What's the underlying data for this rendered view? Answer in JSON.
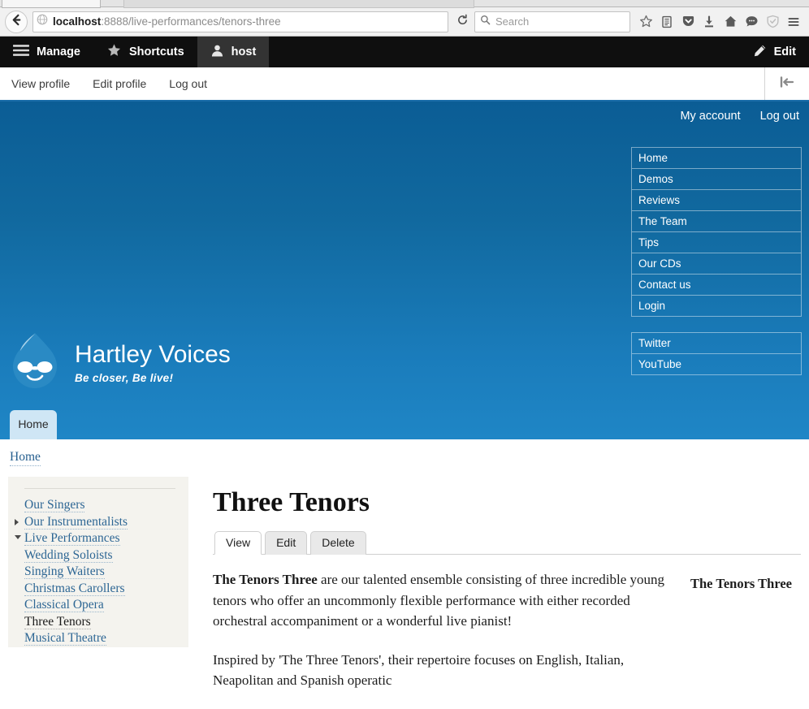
{
  "browser": {
    "url_host": "localhost",
    "url_rest": ":8888/live-performances/tenors-three",
    "search_placeholder": "Search"
  },
  "admin_toolbar": {
    "tabs": [
      {
        "label": "Manage",
        "icon": "hamburger-icon",
        "active": false
      },
      {
        "label": "Shortcuts",
        "icon": "star-icon",
        "active": false
      },
      {
        "label": "host",
        "icon": "user-icon",
        "active": true
      }
    ],
    "edit_label": "Edit",
    "submenu": [
      "View profile",
      "Edit profile",
      "Log out"
    ]
  },
  "hero": {
    "user_links": [
      "My account",
      "Log out"
    ],
    "primary_menu": [
      "Home",
      "Demos",
      "Reviews",
      "The Team",
      "Tips",
      "Our CDs",
      "Contact us",
      "Login"
    ],
    "social_menu": [
      "Twitter",
      "YouTube"
    ],
    "site_name": "Hartley Voices",
    "slogan": "Be closer, Be live!",
    "home_tab": "Home"
  },
  "breadcrumb": [
    "Home"
  ],
  "sidebar": {
    "items": [
      {
        "label": "Our Singers",
        "marker": "none",
        "active": false
      },
      {
        "label": "Our Instrumentalists",
        "marker": "closed",
        "active": false
      },
      {
        "label": "Live Performances",
        "marker": "open",
        "active": false
      },
      {
        "label": "Wedding Soloists",
        "marker": "none",
        "active": false
      },
      {
        "label": "Singing Waiters",
        "marker": "none",
        "active": false
      },
      {
        "label": "Christmas Carollers",
        "marker": "none",
        "active": false
      },
      {
        "label": "Classical Opera",
        "marker": "none",
        "active": false
      },
      {
        "label": "Three Tenors",
        "marker": "none",
        "active": true
      },
      {
        "label": "Musical Theatre",
        "marker": "none",
        "active": false
      }
    ]
  },
  "node": {
    "title": "Three Tenors",
    "tabs": [
      {
        "label": "View",
        "active": true
      },
      {
        "label": "Edit",
        "active": false
      },
      {
        "label": "Delete",
        "active": false
      }
    ],
    "para1_bold": "The Tenors Three",
    "para1_rest": " are our talented ensemble consisting of three incredible young tenors who offer an uncommonly flexible performance with either recorded orchestral accompaniment or a wonderful live pianist!",
    "para2": "Inspired by 'The Three Tenors', their repertoire focuses on English, Italian, Neapolitan and Spanish operatic",
    "aside_caption": "The Tenors Three"
  },
  "colors": {
    "hero_top": "#0b5d95",
    "hero_bottom": "#1f86c6",
    "admin_bar": "#0f0f0f",
    "link_blue": "#2d6694",
    "sidebar_bg": "#f4f3ee"
  }
}
